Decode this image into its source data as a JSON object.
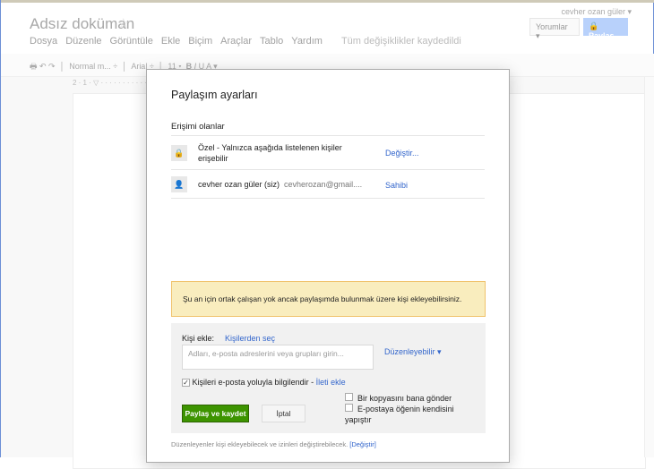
{
  "doc": {
    "title": "Adsız doküman",
    "user": "cevher ozan güler ▾",
    "comments_label": "Yorumlar ▾",
    "share_label": "🔒 Paylaş",
    "menu": [
      "Dosya",
      "Düzenle",
      "Görüntüle",
      "Ekle",
      "Biçim",
      "Araçlar",
      "Tablo",
      "Yardım"
    ],
    "saved_status": "Tüm değişiklikler kaydedildi",
    "toolbar": {
      "style": "Normal m... ÷",
      "font": "Arial ÷",
      "size": "11 ▾"
    },
    "ruler": "2 · 1 · ▽ · · · · · · · · · · · · · · · · · · · · · · · · · · · · 17 · 18 · 19"
  },
  "dialog": {
    "title": "Paylaşım ayarları",
    "access_heading": "Erişimi olanlar",
    "rows": [
      {
        "icon": "lock-icon",
        "text": "Özel - Yalnızca aşağıda listelenen kişiler erişebilir",
        "action": "Değiştir..."
      },
      {
        "icon": "person-icon",
        "name": "cevher ozan güler (siz)",
        "email": "cevherozan@gmail....",
        "role": "Sahibi"
      }
    ],
    "notice": "Şu an için ortak çalışan yok ancak paylaşımda bulunmak üzere kişi ekleyebilirsiniz.",
    "add": {
      "label": "Kişi ekle:",
      "choose_link": "Kişilerden seç",
      "placeholder": "Adları, e-posta adreslerini veya grupları girin...",
      "permission": "Düzenleyebilir ▾",
      "notify_label": "Kişileri e-posta yoluyla bilgilendir - ",
      "notify_checked": true,
      "message_link": "İleti ekle",
      "copy_label": "Bir kopyasını bana gönder",
      "paste_label": "E-postaya öğenin kendisini yapıştır",
      "share_button": "Paylaş ve kaydet",
      "cancel_button": "İptal"
    },
    "footer": "Düzenleyenler kişi ekleyebilecek ve izinleri değiştirebilecek. ",
    "footer_link": "[Değiştir]"
  }
}
